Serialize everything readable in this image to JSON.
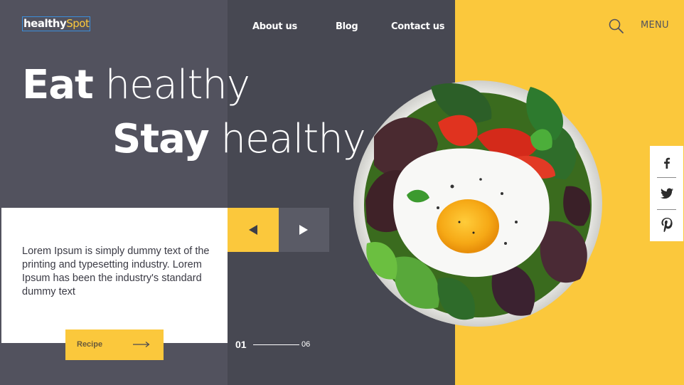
{
  "logo": {
    "part1": "healthy",
    "part2": "Spot"
  },
  "nav": [
    {
      "label": "About us"
    },
    {
      "label": "Blog"
    },
    {
      "label": "Contact us"
    }
  ],
  "header": {
    "menu_label": "MENU",
    "search_icon": "search-icon"
  },
  "hero": {
    "line1_bold": "Eat",
    "line1_light": "healthy",
    "line2_bold": "Stay",
    "line2_light": "healthy"
  },
  "card": {
    "text": "Lorem Ipsum is simply dummy text of the printing and typesetting industry. Lorem Ipsum has been the industry's standard dummy text",
    "button_label": "Recipe"
  },
  "slider": {
    "current": "01",
    "total": "06",
    "prev_icon": "triangle-left-icon",
    "next_icon": "triangle-right-icon"
  },
  "social": [
    {
      "icon": "facebook-icon"
    },
    {
      "icon": "twitter-icon"
    },
    {
      "icon": "pinterest-icon"
    }
  ],
  "colors": {
    "accent": "#fbc83c",
    "dark_left": "#52525e",
    "dark_mid": "#474852",
    "white": "#ffffff"
  }
}
